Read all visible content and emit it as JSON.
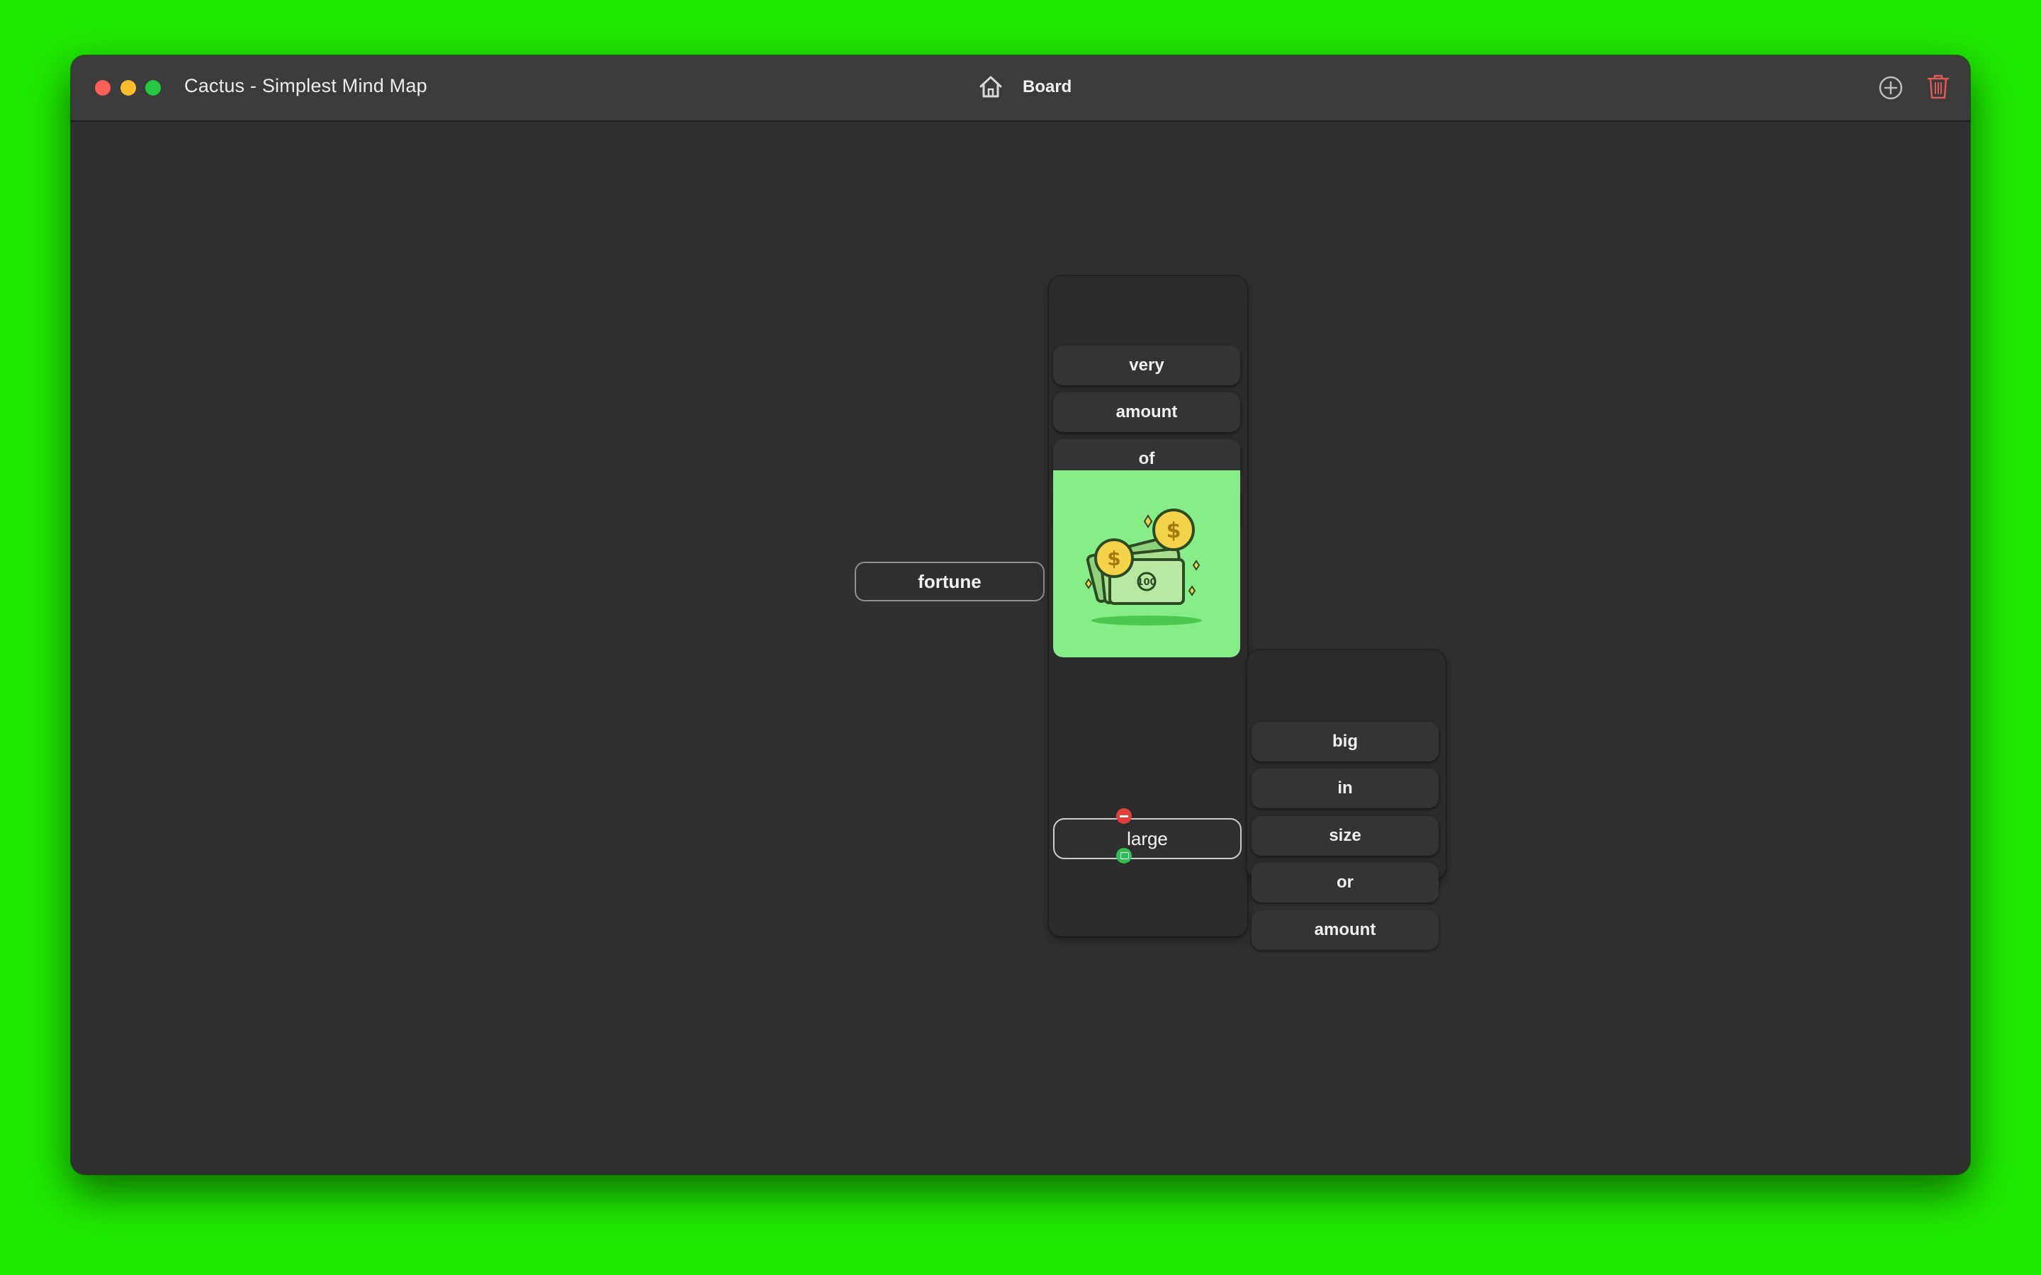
{
  "window": {
    "app_title": "Cactus - Simplest Mind Map",
    "center_title": "Board"
  },
  "toolbar": {
    "home_icon": "house-icon",
    "add_icon": "plus-circle-icon",
    "trash_icon": "trash-icon"
  },
  "mindmap": {
    "root": "fortune",
    "definition_1": [
      "very",
      "amount",
      "of",
      "money"
    ],
    "image_alt": "money",
    "selected_node": "large",
    "definition_2": [
      "big",
      "in",
      "size",
      "or",
      "amount"
    ]
  },
  "colors": {
    "background": "#1fe800",
    "window": "#303030",
    "titlebar": "#3b3b3b",
    "image_bg": "#88ed88",
    "remove_handle": "#e0413b",
    "add_handle": "#3b7ae6",
    "image_handle": "#2fbf55",
    "trash": "#e05a55"
  }
}
